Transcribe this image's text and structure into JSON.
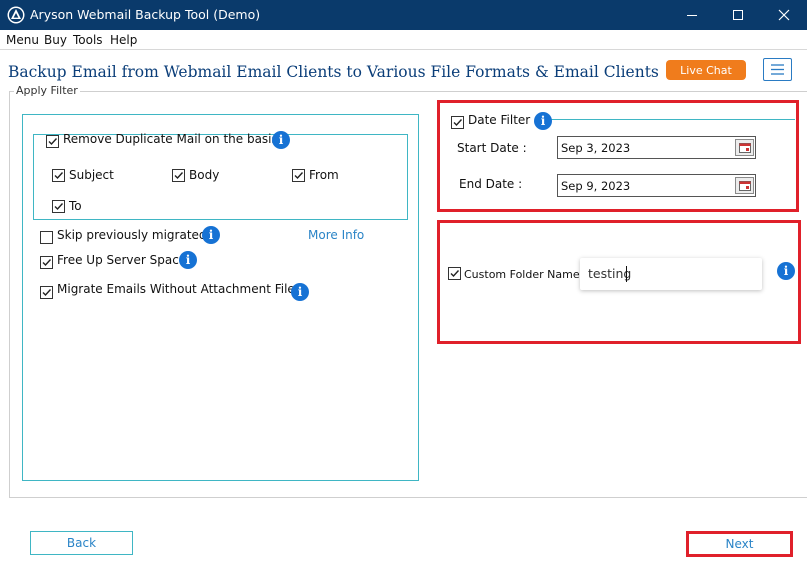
{
  "window": {
    "title": "Aryson Webmail Backup Tool (Demo)",
    "logo_icon": "app-logo-icon",
    "controls": [
      "minimize-icon",
      "maximize-icon",
      "close-icon"
    ]
  },
  "menubar": {
    "items": [
      {
        "label": "Menu"
      },
      {
        "label": "Buy"
      },
      {
        "label": "Tools"
      },
      {
        "label": "Help"
      }
    ]
  },
  "header": {
    "title": "Backup Email from Webmail Email Clients to Various File Formats & Email Clients",
    "live_chat_label": "Live Chat",
    "menu_icon": "hamburger-icon"
  },
  "apply_filter": {
    "label": "Apply Filter",
    "remove_duplicate": {
      "label": "Remove Duplicate Mail on the basis",
      "checked": true,
      "options": [
        {
          "label": "Subject",
          "checked": true
        },
        {
          "label": "Body",
          "checked": true
        },
        {
          "label": "From",
          "checked": true
        },
        {
          "label": "To",
          "checked": true
        }
      ]
    },
    "skip_migrated": {
      "label": "Skip previously migrated",
      "checked": false
    },
    "more_info_label": "More Info",
    "free_up_space": {
      "label": "Free Up Server Space",
      "checked": true
    },
    "without_attachments": {
      "label": "Migrate Emails Without Attachment Files",
      "checked": true
    }
  },
  "date_filter": {
    "label": "Date Filter",
    "checked": true,
    "start_label": "Start Date :",
    "start_value": "Sep 3, 2023",
    "end_label": "End Date :",
    "end_value": "Sep 9, 2023"
  },
  "custom_folder": {
    "label": "Custom Folder Name",
    "checked": true,
    "value": "testing"
  },
  "footer": {
    "back_label": "Back",
    "next_label": "Next"
  },
  "colors": {
    "titlebar": "#0a3a6b",
    "accent": "#2a84c7",
    "teal_border": "#3fb6c4",
    "highlight_red": "#e0202a",
    "live_chat": "#f07c1c",
    "info_blue": "#1672d4"
  }
}
